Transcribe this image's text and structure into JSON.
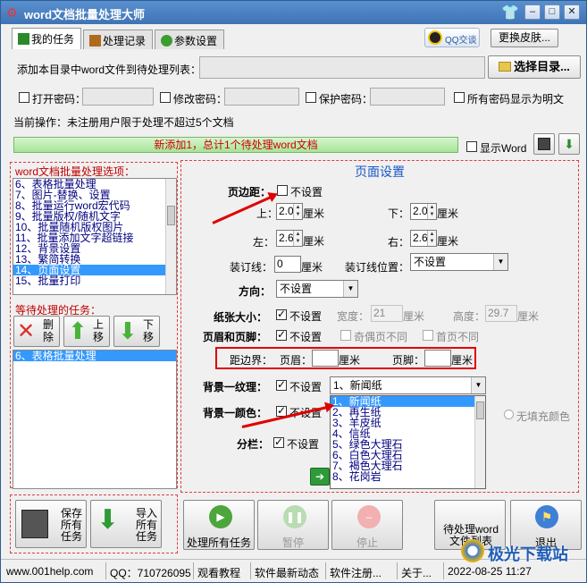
{
  "app": {
    "title": "word文档批量处理大师"
  },
  "tabs": [
    {
      "label": "我的任务"
    },
    {
      "label": "处理记录"
    },
    {
      "label": "参数设置"
    }
  ],
  "qq_button": "QQ交谈",
  "change_skin": "更换皮肤...",
  "add_dir_label": "添加本目录中word文件到待处理列表：",
  "select_dir": "选择目录...",
  "passwords": {
    "open": "打开密码：",
    "modify": "修改密码：",
    "protect": "保护密码：",
    "show_plain": "所有密码显示为明文"
  },
  "current_op": "当前操作：未注册用户限于处理不超过5个文档",
  "progress_text": "新添加1，总计1个待处理word文档",
  "show_word": "显示Word",
  "options_title": "word文档批量处理选项：",
  "options": [
    "6、表格批量处理",
    "7、图片-替换、设置",
    "8、批量运行word宏代码",
    "9、批量版权/随机文字",
    "10、批量随机版权图片",
    "11、批量添加文字超链接",
    "12、背景设置",
    "13、繁简转换",
    "14、页面设置",
    "15、批量打印"
  ],
  "options_selected_index": 8,
  "pending_title": "等待处理的任务：",
  "task_buttons": {
    "delete": "删除",
    "up": "上移",
    "down": "下移"
  },
  "pending_tasks": [
    "6、表格批量处理"
  ],
  "page_setup": {
    "header": "页面设置",
    "margin_label": "页边距：",
    "not_set": "不设置",
    "top": "上：",
    "top_value": "2.0",
    "bottom": "下：",
    "bottom_value": "2.0",
    "left": "左：",
    "left_value": "2.6",
    "right": "右：",
    "right_value": "2.6",
    "unit": "厘米",
    "gutter": "装订线：",
    "gutter_value": "0",
    "gutter_pos": "装订线位置：",
    "gutter_pos_value": "不设置",
    "orientation": "方向：",
    "orientation_value": "不设置",
    "paper": "纸张大小：",
    "width": "宽度：",
    "width_value": "21",
    "height": "高度：",
    "height_value": "29.7",
    "header_footer": "页眉和页脚：",
    "odd_even": "奇偶页不同",
    "first_page": "首页不同",
    "distance": "距边界：",
    "hdr_label": "页眉：",
    "ftr_label": "页脚：",
    "bg_texture": "背景一纹理：",
    "texture_value": "1、新闻纸",
    "bg_color": "背景一颜色：",
    "no_fill": "无填充颜色",
    "columns": "分栏："
  },
  "texture_options": [
    "1、新闻纸",
    "2、再生纸",
    "3、羊皮纸",
    "4、信纸",
    "5、绿色大理石",
    "6、白色大理石",
    "7、褐色大理石",
    "8、花岗岩"
  ],
  "texture_selected_index": 0,
  "bottom_buttons": {
    "save": "保存所有任务",
    "import": "导入所有任务",
    "process": "处理所有任务",
    "pause": "暂停",
    "stop": "停止",
    "pending_list": "待处理word文件列表",
    "exit": "退出"
  },
  "status": {
    "site": "www.001help.com",
    "qq": "QQ：710726095",
    "tutorial": "观看教程",
    "news": "软件最新动态",
    "register": "软件注册...",
    "about": "关于...",
    "datetime": "2022-08-25  11:27"
  },
  "watermark": "极光下载站",
  "colors": {
    "title_bg": "#3e74b6",
    "accent_red": "#e00000",
    "header_blue": "#1b57c8",
    "progress_green": "#a5e495"
  }
}
